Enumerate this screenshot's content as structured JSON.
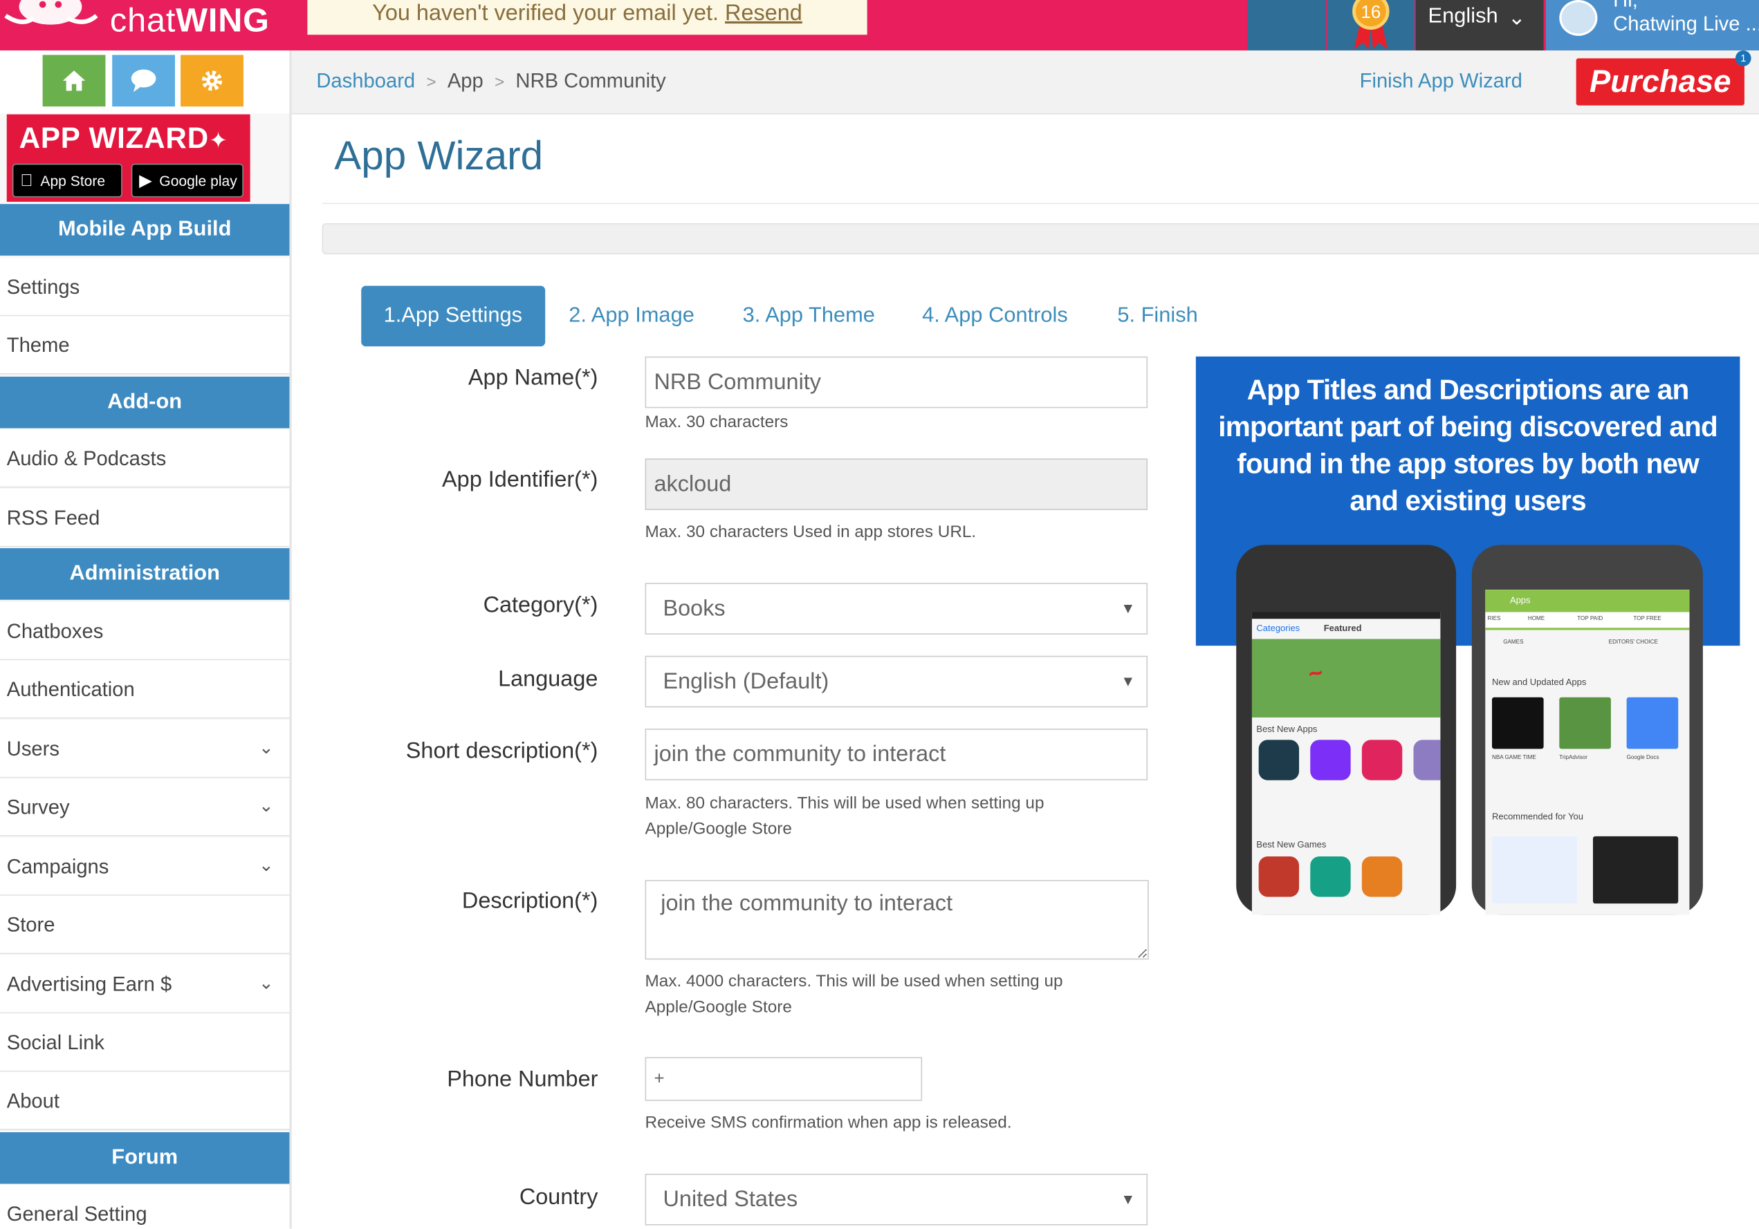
{
  "brand": {
    "logo_chat": "chat",
    "logo_wing": "WING"
  },
  "topbar": {
    "verify_text": "You haven't verified your email yet. ",
    "verify_link": "Resend",
    "medal_count": "16",
    "language": "English",
    "user_greeting": "Hi,",
    "user_name": "Chatwing Live ..."
  },
  "breadcrumb": [
    "Dashboard",
    "App",
    "NRB Community"
  ],
  "header_actions": {
    "finish_wizard": "Finish App Wizard",
    "purchase": "Purchase",
    "notification_count": "1"
  },
  "sidebar": {
    "wizard_banner": {
      "title": "APP WIZARD",
      "app_store": "App Store",
      "google_play": "Google play"
    },
    "sections": [
      {
        "title": "Mobile App Build",
        "items": [
          {
            "label": "Settings"
          },
          {
            "label": "Theme"
          }
        ]
      },
      {
        "title": "Add-on",
        "items": [
          {
            "label": "Audio & Podcasts"
          },
          {
            "label": "RSS Feed"
          }
        ]
      },
      {
        "title": "Administration",
        "items": [
          {
            "label": "Chatboxes"
          },
          {
            "label": "Authentication"
          },
          {
            "label": "Users"
          },
          {
            "label": "Survey"
          },
          {
            "label": "Campaigns"
          },
          {
            "label": "Store"
          },
          {
            "label": "Advertising Earn $"
          },
          {
            "label": "Social Link"
          },
          {
            "label": "About"
          }
        ]
      },
      {
        "title": "Forum",
        "items": [
          {
            "label": "General Setting"
          }
        ]
      }
    ]
  },
  "page": {
    "title": "App Wizard"
  },
  "tabs": [
    "1.App Settings",
    "2. App Image",
    "3. App Theme",
    "4. App Controls",
    "5. Finish"
  ],
  "form": {
    "app_name": {
      "label": "App Name(*)",
      "value": "NRB Community",
      "help": "Max. 30 characters"
    },
    "app_identifier": {
      "label": "App Identifier(*)",
      "value": "akcloud",
      "help": "Max. 30 characters Used in app stores URL."
    },
    "category": {
      "label": "Category(*)",
      "value": "Books"
    },
    "language": {
      "label": "Language",
      "value": "English (Default)"
    },
    "short_description": {
      "label": "Short description(*)",
      "value": "join the community to interact",
      "help": "Max. 80 characters. This will be used when setting up Apple/Google Store"
    },
    "description": {
      "label": "Description(*)",
      "value": "join the community to interact",
      "help": "Max. 4000 characters. This will be used when setting up Apple/Google Store"
    },
    "phone": {
      "label": "Phone Number",
      "value": "+",
      "help": "Receive SMS confirmation when app is released."
    },
    "country": {
      "label": "Country",
      "value": "United States"
    }
  },
  "promo": {
    "headline": "App Titles and Descriptions are an important part of being discovered and found in the app stores by both new and existing users",
    "ios_tabs": [
      "Categories",
      "Featured"
    ],
    "ios_sections": [
      "Best New Apps",
      "Best New Games"
    ],
    "android_header": "Apps",
    "android_tabs": [
      "RIES",
      "HOME",
      "TOP PAID",
      "TOP FREE"
    ],
    "android_chips": [
      "GAMES",
      "EDITORS' CHOICE"
    ],
    "android_sections": [
      "New and Updated Apps",
      "Recommended for You"
    ],
    "android_apps": [
      "NBA GAME TIME",
      "TripAdvisor",
      "Google Docs"
    ]
  },
  "colors": {
    "brand_pink": "#e91e5c",
    "nav_blue": "#3d8bc1",
    "link_blue": "#3c8dbc",
    "purchase_red": "#e8202a",
    "promo_blue": "#1766c7"
  }
}
